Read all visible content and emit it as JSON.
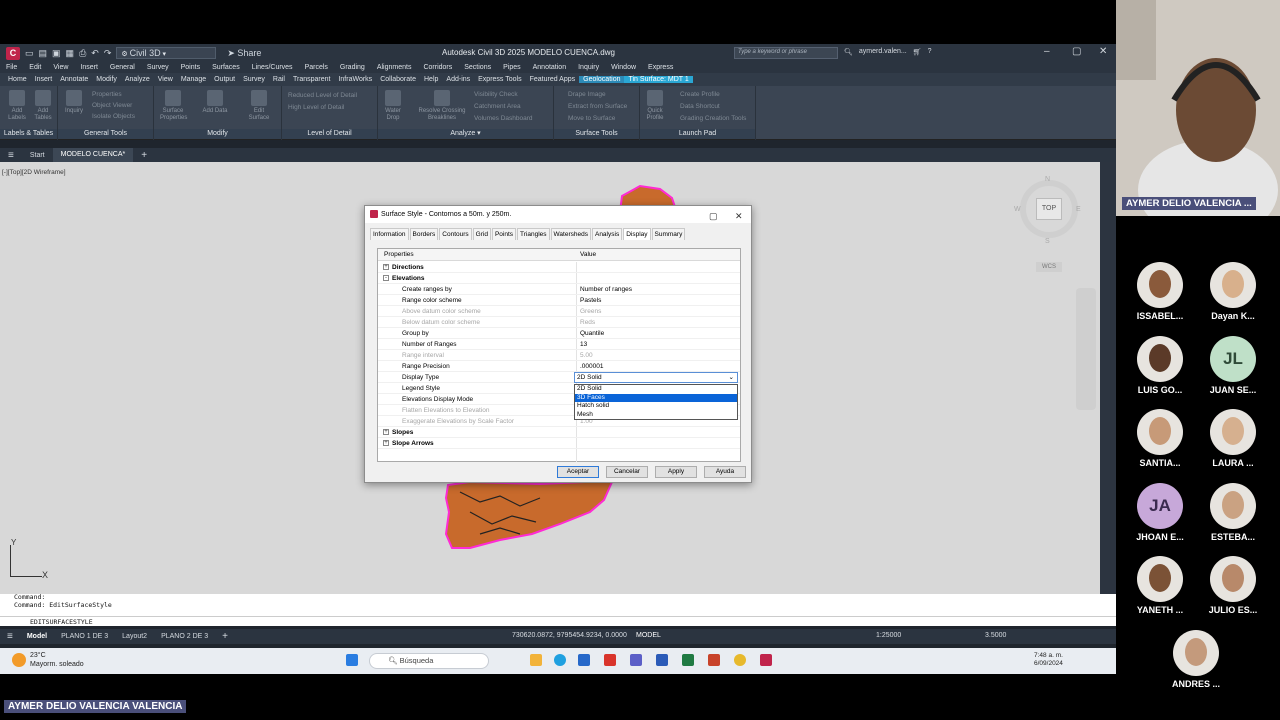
{
  "app": {
    "workspace": "Civil 3D",
    "share": "Share",
    "title": "Autodesk Civil 3D 2025   MODELO CUENCA.dwg",
    "search_placeholder": "Type a keyword or phrase",
    "user": "aymerd.valen..."
  },
  "menu": [
    "File",
    "Edit",
    "View",
    "Insert",
    "General",
    "Survey",
    "Points",
    "Surfaces",
    "Lines/Curves",
    "Parcels",
    "Grading",
    "Alignments",
    "Corridors",
    "Sections",
    "Pipes",
    "Annotation",
    "Inquiry",
    "Window",
    "Express"
  ],
  "ribbon_tabs": [
    "Home",
    "Insert",
    "Annotate",
    "Modify",
    "Analyze",
    "View",
    "Manage",
    "Output",
    "Survey",
    "Rail",
    "Transparent",
    "InfraWorks",
    "Collaborate",
    "Help",
    "Add-ins",
    "Express Tools",
    "Featured Apps",
    "Geolocation",
    "Tin Surface: MDT 1"
  ],
  "ribbon": {
    "labels_tables": {
      "title": "Labels & Tables",
      "b1": "Add Labels",
      "b2": "Add Tables"
    },
    "general_tools": {
      "title": "General Tools",
      "b1": "Inquiry",
      "s1": "Properties",
      "s2": "Object Viewer",
      "s3": "Isolate Objects"
    },
    "modify": {
      "title": "Modify",
      "b1": "Surface Properties",
      "b2": "Add Data",
      "b3": "Edit Surface"
    },
    "lod": {
      "title": "Level of Detail",
      "s1": "Reduced Level of Detail",
      "s2": "High Level of Detail"
    },
    "analyze": {
      "title": "Analyze",
      "b1": "Water Drop",
      "b2": "Resolve Crossing Breaklines",
      "s1": "Visibility Check",
      "s2": "Catchment Area",
      "s3": "Volumes Dashboard"
    },
    "surface_tools": {
      "title": "Surface Tools",
      "s1": "Drape Image",
      "s2": "Extract from Surface",
      "s3": "Move to Surface"
    },
    "launch_pad": {
      "title": "Launch Pad",
      "b1": "Quick Profile",
      "s1": "Create Profile",
      "s2": "Data Shortcut",
      "s3": "Grading Creation Tools"
    }
  },
  "doc_tabs": [
    "Start",
    "MODELO CUENCA*"
  ],
  "viewport": {
    "label": "[-][Top][2D Wireframe]",
    "viewcube": "TOP",
    "wcs": "WCS",
    "n": "N",
    "s": "S",
    "e": "E",
    "w": "W",
    "axis_x": "X",
    "axis_y": "Y"
  },
  "command": {
    "line1": "Command:",
    "line2": "Command: EditSurfaceStyle",
    "input": "EDITSURFACESTYLE"
  },
  "status": {
    "tabs": [
      "Model",
      "PLANO 1 DE 3",
      "Layout2",
      "PLANO 2 DE 3"
    ],
    "coords": "730620.0872, 9795454.9234, 0.0000",
    "mode": "MODEL",
    "scale": "1:25000",
    "value": "3.5000"
  },
  "taskbar": {
    "temp": "23°C",
    "weather": "Mayorm. soleado",
    "search": "Búsqueda",
    "time": "7:48 a. m.",
    "date": "6/09/2024"
  },
  "dialog": {
    "title": "Surface Style - Contornos a 50m. y 250m.",
    "tabs": [
      "Information",
      "Borders",
      "Contours",
      "Grid",
      "Points",
      "Triangles",
      "Watersheds",
      "Analysis",
      "Display",
      "Summary"
    ],
    "col_props": "Properties",
    "col_value": "Value",
    "rows": [
      {
        "k": "Directions",
        "v": "",
        "cat": true,
        "sign": "+"
      },
      {
        "k": "Elevations",
        "v": "",
        "cat": true,
        "sign": "-"
      },
      {
        "k": "Create ranges by",
        "v": "Number of ranges"
      },
      {
        "k": "Range color scheme",
        "v": "Pastels"
      },
      {
        "k": "Above datum color scheme",
        "v": "Greens",
        "dis": true
      },
      {
        "k": "Below datum color scheme",
        "v": "Reds",
        "dis": true
      },
      {
        "k": "Group by",
        "v": "Quantile"
      },
      {
        "k": "Number of Ranges",
        "v": "13"
      },
      {
        "k": "Range interval",
        "v": "5.00",
        "dis": true
      },
      {
        "k": "Range Precision",
        "v": ".000001"
      },
      {
        "k": "Display Type",
        "v": ""
      },
      {
        "k": "Legend Style",
        "v": ""
      },
      {
        "k": "Elevations Display Mode",
        "v": ""
      },
      {
        "k": "Flatten Elevations to Elevation",
        "v": "",
        "dis": true
      },
      {
        "k": "Exaggerate Elevations by Scale Factor",
        "v": "1.00",
        "dis": true
      },
      {
        "k": "Slopes",
        "v": "",
        "cat": true,
        "sign": "+"
      },
      {
        "k": "Slope Arrows",
        "v": "",
        "cat": true,
        "sign": "+"
      }
    ],
    "dropdown_value": "2D Solid",
    "dropdown_options": [
      "2D Solid",
      "3D Faces",
      "Hatch solid",
      "Mesh"
    ],
    "buttons": {
      "ok": "Aceptar",
      "cancel": "Cancelar",
      "apply": "Apply",
      "help": "Ayuda"
    }
  },
  "meeting": {
    "presenter": "AYMER DELIO  VALENCIA ...",
    "bottom_tag": "AYMER DELIO  VALENCIA VALENCIA",
    "participants": [
      {
        "name": "ISSABEL..."
      },
      {
        "name": "Dayan K..."
      },
      {
        "name": "LUIS GO..."
      },
      {
        "name": "JUAN SE...",
        "initials": "JL"
      },
      {
        "name": "SANTIA..."
      },
      {
        "name": "LAURA ..."
      },
      {
        "name": "JHOAN E...",
        "initials": "JA"
      },
      {
        "name": "ESTEBA..."
      },
      {
        "name": "YANETH ..."
      },
      {
        "name": "JULIO ES..."
      },
      {
        "name": "ANDRES ..."
      }
    ]
  },
  "colors": {
    "accent": "#2c8bb8",
    "brand": "#c0244b",
    "surface_edge": "#ff2ad4",
    "surface_fill": "#c86a2c"
  }
}
